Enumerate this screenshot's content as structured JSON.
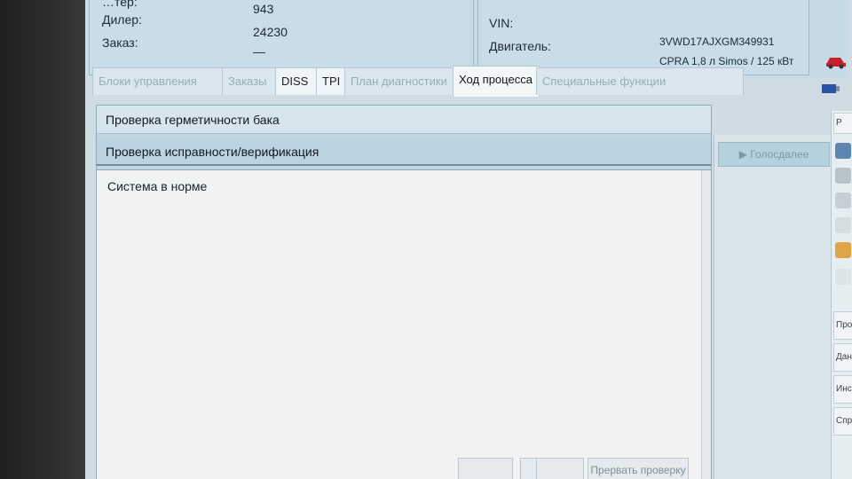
{
  "header": {
    "partial_label": "…тер:",
    "partial_value": "943",
    "dealer_label": "Дилер:",
    "dealer_value": "24230",
    "order_label": "Заказ:",
    "order_value": "—",
    "vin_label": "VIN:",
    "vin_value": "3VWD17AJXGM349931",
    "engine_label": "Двигатель:",
    "engine_value": "CPRA 1,8 л Simos / 125 кВт"
  },
  "header_icons": [
    "car-icon",
    "network-icon",
    "key-icon",
    "usb-icon",
    "lightbulb-icon"
  ],
  "tabs": [
    {
      "label": "Блоки управления",
      "state": "disabled"
    },
    {
      "label": "Заказы",
      "state": "disabled"
    },
    {
      "label": "DISS",
      "state": "enabled"
    },
    {
      "label": "TPI",
      "state": "enabled"
    },
    {
      "label": "План диагностики",
      "state": "disabled"
    },
    {
      "label": "Ход процесса",
      "state": "active"
    },
    {
      "label": "Специальные функции",
      "state": "disabled"
    }
  ],
  "main": {
    "row1": "Проверка герметичности бака",
    "row2": "Проверка исправности/верификация",
    "message": "Система в норме"
  },
  "side": {
    "next_button": "▶ Голосдалее"
  },
  "bottom": {
    "check_button": "Прервать проверку"
  },
  "far_right": {
    "top_label": "Р",
    "buttons": [
      "Прот",
      "Данн",
      "Инстр",
      "Справ"
    ]
  },
  "colors": {
    "screen_bg": "#cfdce3",
    "tab_active": "#f4f7f8",
    "text_area": "#f1f3f3"
  }
}
